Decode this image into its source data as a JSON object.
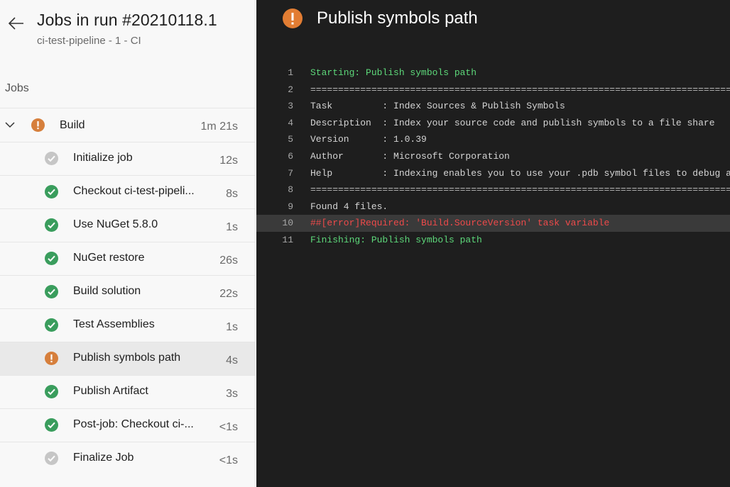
{
  "header": {
    "title": "Jobs in run #20210118.1",
    "subtitle": "ci-test-pipeline - 1 - CI"
  },
  "jobs_section_label": "Jobs",
  "job_group": {
    "name": "Build",
    "duration": "1m 21s",
    "status": "warning"
  },
  "steps": [
    {
      "name": "Initialize job",
      "duration": "12s",
      "status": "skipped"
    },
    {
      "name": "Checkout ci-test-pipeli...",
      "duration": "8s",
      "status": "success"
    },
    {
      "name": "Use NuGet 5.8.0",
      "duration": "1s",
      "status": "success"
    },
    {
      "name": "NuGet restore",
      "duration": "26s",
      "status": "success"
    },
    {
      "name": "Build solution",
      "duration": "22s",
      "status": "success"
    },
    {
      "name": "Test Assemblies",
      "duration": "1s",
      "status": "success"
    },
    {
      "name": "Publish symbols path",
      "duration": "4s",
      "status": "warning",
      "selected": true
    },
    {
      "name": "Publish Artifact",
      "duration": "3s",
      "status": "success"
    },
    {
      "name": "Post-job: Checkout ci-...",
      "duration": "<1s",
      "status": "success"
    },
    {
      "name": "Finalize Job",
      "duration": "<1s",
      "status": "skipped"
    }
  ],
  "detail": {
    "title": "Publish symbols path",
    "log": [
      {
        "num": "1",
        "text": "Starting: Publish symbols path",
        "style": "green"
      },
      {
        "num": "2",
        "text": "==============================================================================",
        "style": "sep"
      },
      {
        "num": "3",
        "text": "Task         : Index Sources & Publish Symbols",
        "style": "normal"
      },
      {
        "num": "4",
        "text": "Description  : Index your source code and publish symbols to a file share",
        "style": "normal"
      },
      {
        "num": "5",
        "text": "Version      : 1.0.39",
        "style": "normal"
      },
      {
        "num": "6",
        "text": "Author       : Microsoft Corporation",
        "style": "normal"
      },
      {
        "num": "7",
        "text": "Help         : Indexing enables you to use your .pdb symbol files to debug a",
        "style": "normal"
      },
      {
        "num": "8",
        "text": "==============================================================================",
        "style": "sep"
      },
      {
        "num": "9",
        "text": "Found 4 files.",
        "style": "normal"
      },
      {
        "num": "10",
        "text": "##[error]Required: 'Build.SourceVersion' task variable",
        "style": "red"
      },
      {
        "num": "11",
        "text": "Finishing: Publish symbols path",
        "style": "green"
      }
    ]
  },
  "colors": {
    "success": "#3a9d5d",
    "skipped": "#c6c6c6",
    "warning": "#d67f3c",
    "log_green": "#5dd87a",
    "log_red": "#ee4a4a"
  }
}
